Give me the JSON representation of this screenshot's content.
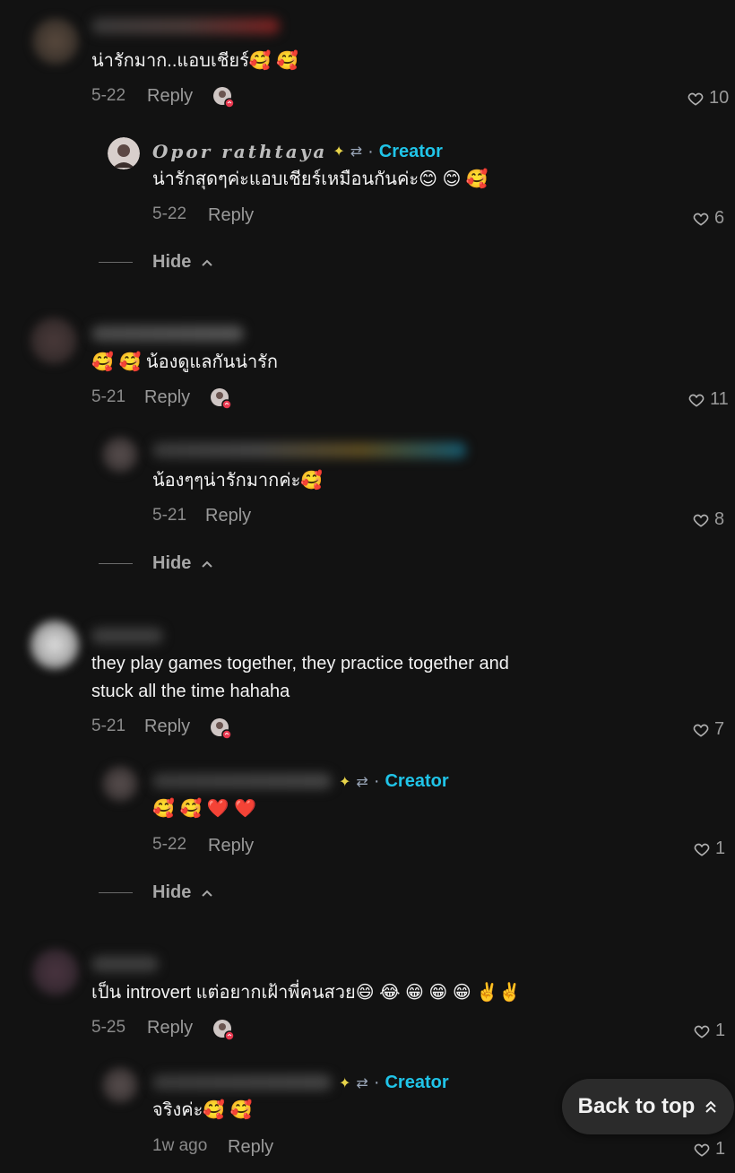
{
  "comments": [
    {
      "text": "น่ารักมาก..แอบเชียร์🥰 🥰",
      "date": "5-22",
      "reply": "Reply",
      "likes": "10",
      "reply_item": {
        "creator_name": "Opor rathtaya",
        "creator_badge": "Creator",
        "text": "น่ารักสุดๆค่ะแอบเชียร์เหมือนกันค่ะ😊 😊 🥰",
        "date": "5-22",
        "reply": "Reply",
        "likes": "6"
      },
      "hide": "Hide"
    },
    {
      "text": "🥰 🥰 น้องดูแลกันน่ารัก",
      "date": "5-21",
      "reply": "Reply",
      "likes": "11",
      "reply_item": {
        "text": "น้องๆๆน่ารักมากค่ะ🥰",
        "date": "5-21",
        "reply": "Reply",
        "likes": "8"
      },
      "hide": "Hide"
    },
    {
      "text_line1": "they play games together, they practice together and",
      "text_line2": "stuck all the time hahaha",
      "date": "5-21",
      "reply": "Reply",
      "likes": "7",
      "reply_item": {
        "creator_badge": "Creator",
        "text": "🥰 🥰 ❤️ ❤️",
        "date": "5-22",
        "reply": "Reply",
        "likes": "1"
      },
      "hide": "Hide"
    },
    {
      "text": "เป็น introvert แต่อยากเฝ้าพี่คนสวย😄 😂 😁 😁 😁 ✌️✌️",
      "date": "5-25",
      "reply": "Reply",
      "likes": "1",
      "reply_item": {
        "creator_badge": "Creator",
        "text": "จริงค่ะ🥰 🥰",
        "date": "1w ago",
        "reply": "Reply",
        "likes": "1"
      }
    }
  ],
  "back_to_top": "Back to top",
  "icons": {
    "heart": "heart-icon",
    "chevron_up": "chevron-up-icon",
    "double_chevron_up": "double-chevron-up-icon",
    "repost": "repost-icon",
    "sparkle": "sparkle-icon"
  },
  "colors": {
    "creator": "#20c4e8",
    "background": "#121212",
    "liked_badge": "#e8384f"
  }
}
